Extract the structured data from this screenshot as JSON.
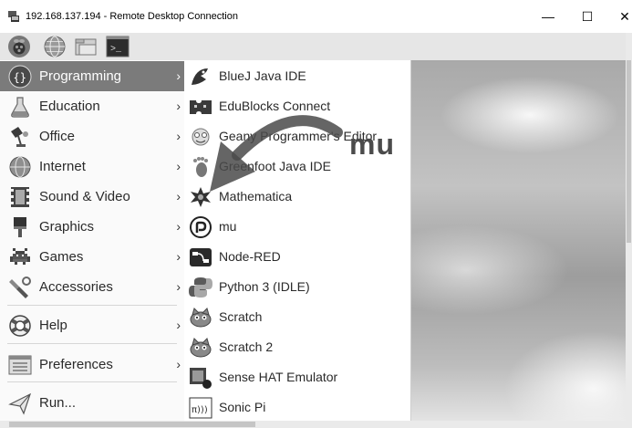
{
  "window": {
    "title": "192.168.137.194 - Remote Desktop Connection",
    "controls": {
      "minimize": "—",
      "maximize": "☐",
      "close": "✕"
    }
  },
  "panel": {
    "icons": [
      "raspberry-icon",
      "web-browser-icon",
      "file-manager-icon",
      "terminal-icon"
    ],
    "terminal_glyph": ">_"
  },
  "menu": {
    "items": [
      {
        "label": "Programming",
        "icon": "programming-icon",
        "selected": true
      },
      {
        "label": "Education",
        "icon": "education-icon"
      },
      {
        "label": "Office",
        "icon": "office-icon"
      },
      {
        "label": "Internet",
        "icon": "internet-icon"
      },
      {
        "label": "Sound & Video",
        "icon": "sound-video-icon"
      },
      {
        "label": "Graphics",
        "icon": "graphics-icon"
      },
      {
        "label": "Games",
        "icon": "games-icon"
      },
      {
        "label": "Accessories",
        "icon": "accessories-icon"
      },
      {
        "label": "Help",
        "icon": "help-icon"
      },
      {
        "label": "Preferences",
        "icon": "preferences-icon"
      },
      {
        "label": "Run...",
        "icon": "run-icon"
      }
    ],
    "arrow": "›"
  },
  "submenu": {
    "items": [
      {
        "label": "BlueJ Java IDE",
        "icon": "bluej-icon"
      },
      {
        "label": "EduBlocks Connect",
        "icon": "edublocks-icon"
      },
      {
        "label": "Geany Programmer's Editor",
        "icon": "geany-icon"
      },
      {
        "label": "Greenfoot Java IDE",
        "icon": "greenfoot-icon"
      },
      {
        "label": "Mathematica",
        "icon": "mathematica-icon"
      },
      {
        "label": "mu",
        "icon": "mu-icon"
      },
      {
        "label": "Node-RED",
        "icon": "node-red-icon"
      },
      {
        "label": "Python 3 (IDLE)",
        "icon": "python-icon"
      },
      {
        "label": "Scratch",
        "icon": "scratch-icon"
      },
      {
        "label": "Scratch 2",
        "icon": "scratch2-icon"
      },
      {
        "label": "Sense HAT Emulator",
        "icon": "sense-hat-icon"
      },
      {
        "label": "Sonic Pi",
        "icon": "sonic-pi-icon"
      }
    ]
  },
  "annotation": {
    "text": "mu"
  },
  "colors": {
    "selected_bg": "#7b7b7b",
    "menu_bg": "#fafafa",
    "panel_bg": "#e6e6e6"
  }
}
